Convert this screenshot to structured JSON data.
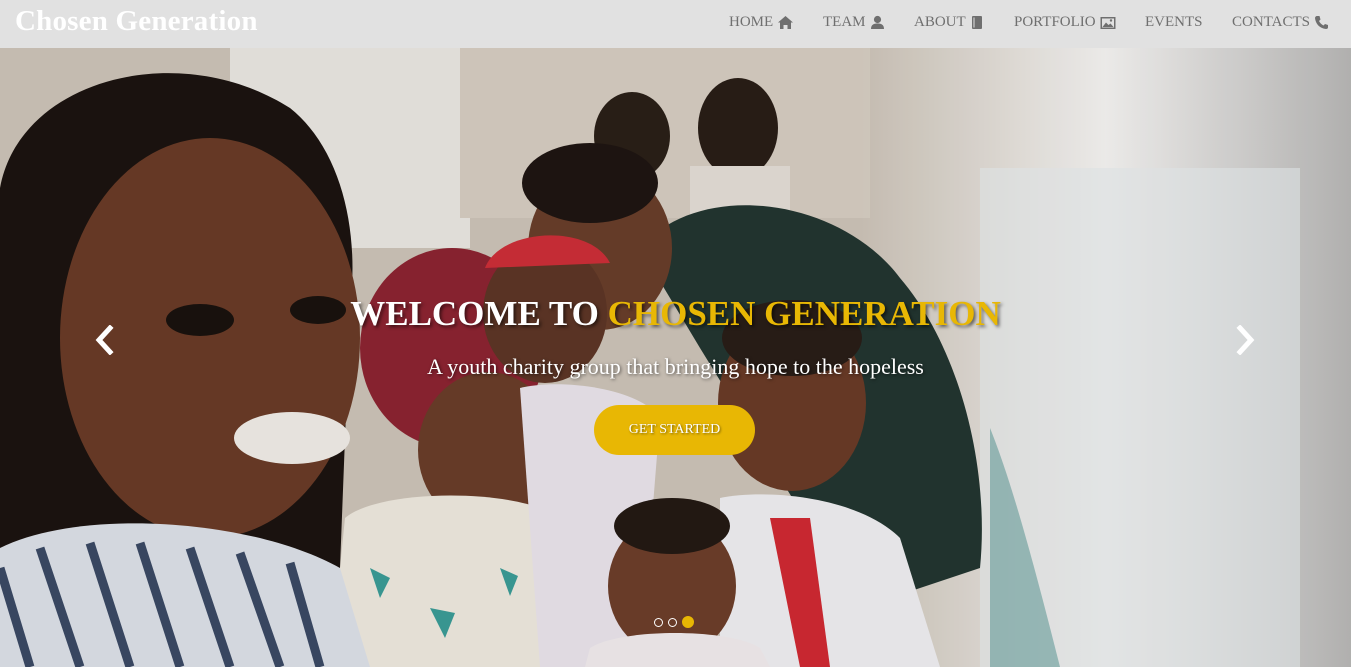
{
  "brand": "Chosen Generation",
  "nav": [
    {
      "label": "HOME",
      "icon": "home-icon"
    },
    {
      "label": "TEAM",
      "icon": "user-icon"
    },
    {
      "label": "ABOUT",
      "icon": "book-icon"
    },
    {
      "label": "PORTFOLIO",
      "icon": "image-icon"
    },
    {
      "label": "EVENTS",
      "icon": ""
    },
    {
      "label": "CONTACTS",
      "icon": "phone-icon"
    }
  ],
  "hero": {
    "headline_prefix": "WELCOME TO ",
    "headline_accent": "CHOSEN GENERATION",
    "tagline": "A youth charity group that bringing hope to the hopeless",
    "cta_label": "GET STARTED",
    "slide_count": 3,
    "active_slide": 3
  },
  "colors": {
    "navbar_bg": "#e1e1e1",
    "nav_text": "#6f6f6f",
    "accent": "#e8b704",
    "white": "#ffffff"
  }
}
